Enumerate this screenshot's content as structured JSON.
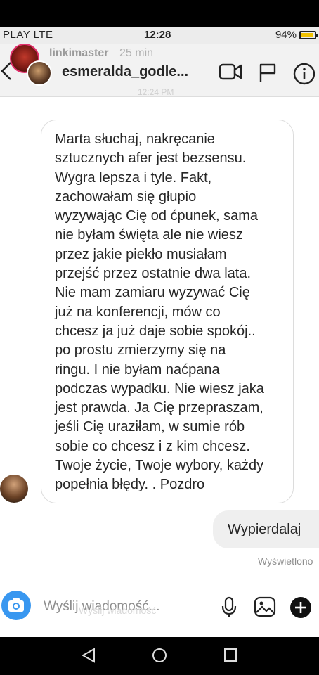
{
  "status_bar": {
    "carrier": "PLAY  LTE",
    "time": "12:28",
    "battery": "94%",
    "battery_level": 0.94
  },
  "header": {
    "notification_user": "linkimaster",
    "notification_time": "25 min",
    "chat_username": "esmeralda_godle...",
    "faint_timestamp": "12:24 PM",
    "icons": [
      "back-icon",
      "video-call-icon",
      "flag-icon",
      "info-icon"
    ]
  },
  "messages": {
    "incoming": {
      "lines": [
        "Marta słuchaj, nakręcanie",
        "sztucznych afer jest bezsensu.",
        "Wygra lepsza i tyle. Fakt,",
        "zachowałam się głupio",
        "wyzywając Cię od ćpunek, sama",
        "nie byłam święta ale nie wiesz",
        "przez jakie piekło musiałam",
        "przejść przez ostatnie dwa lata.",
        "Nie mam zamiaru wyzywać Cię",
        "już na konferencji, mów co",
        "chcesz ja już daje sobie spokój..",
        "po prostu zmierzymy się na",
        "ringu. I nie byłam naćpana",
        "podczas wypadku. Nie wiesz jaka",
        "jest prawda. Ja Cię przepraszam,",
        "jeśli Cię uraziłam, w sumie rób",
        "sobie co chcesz i z kim chcesz.",
        "Twoje życie, Twoje wybory, każdy",
        "popełnia błędy. . Pozdro"
      ]
    },
    "outgoing": {
      "text": "Wypierdalaj",
      "status": "Wyświetlono"
    }
  },
  "composer": {
    "placeholder": "Wyślij wiadomość...",
    "ghost_placeholder": "Wyślij wiadomość"
  },
  "colors": {
    "accent": "#3897f0",
    "outgoing_bubble": "#efefef",
    "battery": "#f2c200"
  }
}
